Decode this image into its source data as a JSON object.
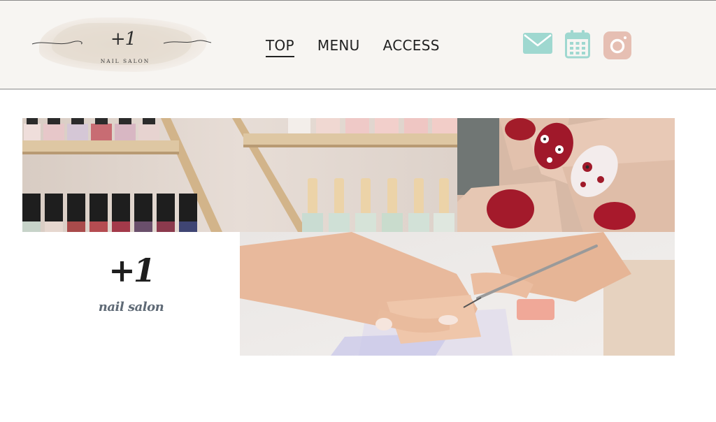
{
  "header": {
    "logo": {
      "mark": "+1",
      "subtitle": "NAIL SALON"
    },
    "nav": [
      {
        "label": "TOP",
        "active": true
      },
      {
        "label": "MENU",
        "active": false
      },
      {
        "label": "ACCESS",
        "active": false
      }
    ],
    "icons": [
      {
        "name": "mail-icon",
        "color": "#9fd8d0"
      },
      {
        "name": "calendar-icon",
        "color": "#9fd8d0"
      },
      {
        "name": "instagram-icon",
        "color": "#e6bfb3"
      }
    ]
  },
  "hero": {
    "brand_mark": "+1",
    "brand_subtitle": "nail salon",
    "images": [
      "nail-polish-shelf-photo",
      "red-floral-nail-art-photo",
      "manicure-in-progress-photo"
    ]
  }
}
